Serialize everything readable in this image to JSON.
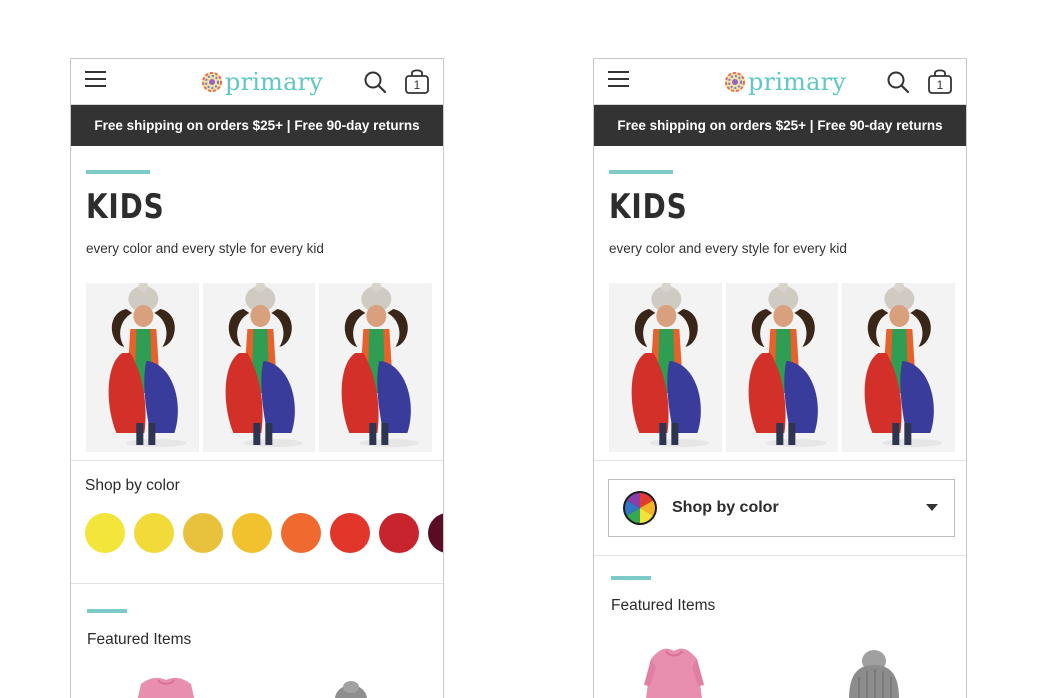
{
  "brand": {
    "name": "primary",
    "accent": "#5fc7c6"
  },
  "header": {
    "menu_icon": "hamburger-menu-icon",
    "search_icon": "search-icon",
    "bag_icon": "shopping-bag-icon",
    "cart_count": "1"
  },
  "promo": {
    "text": "Free shipping on orders $25+ | Free 90-day returns"
  },
  "hero": {
    "title": "KIDS",
    "subtitle": "every color and every style for every kid"
  },
  "variant_a": {
    "shop_by_color": "Shop by color",
    "swatches": [
      "#f4e53b",
      "#f2da3a",
      "#e8c23d",
      "#f1c22e",
      "#f06a30",
      "#e3362b",
      "#c8242e",
      "#5a0c24"
    ],
    "featured_title": "Featured Items"
  },
  "variant_b": {
    "shop_by_color": "Shop by color",
    "dropdown_icon": "chevron-down-icon",
    "featured_title": "Featured Items"
  }
}
